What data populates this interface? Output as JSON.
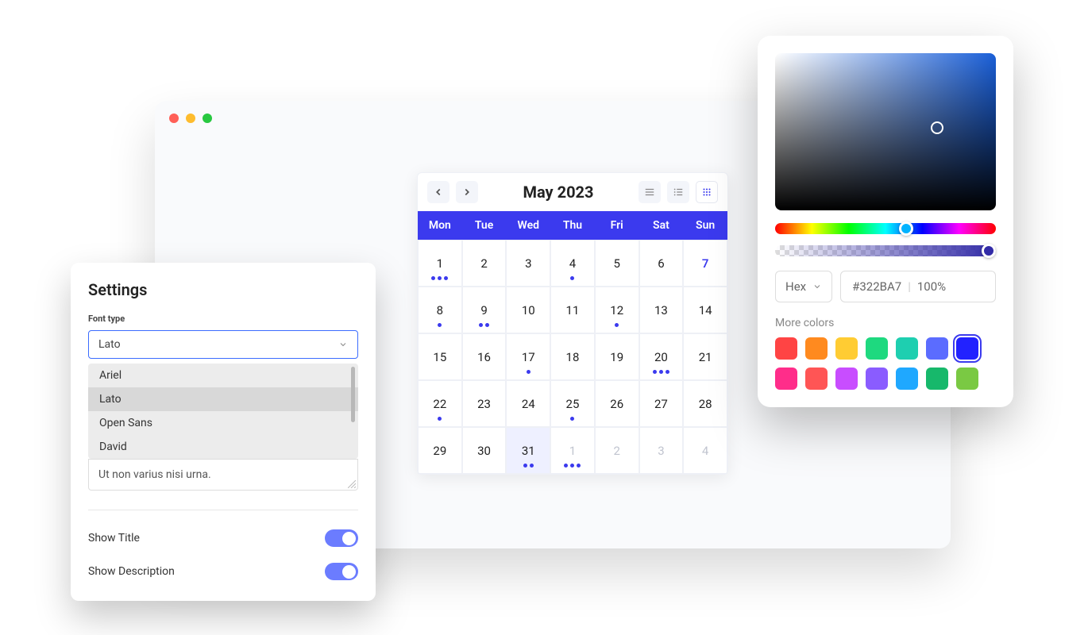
{
  "calendar": {
    "title": "May 2023",
    "days": [
      "Mon",
      "Tue",
      "Wed",
      "Thu",
      "Fri",
      "Sat",
      "Sun"
    ],
    "cells": [
      {
        "n": "1",
        "dots": 3
      },
      {
        "n": "2"
      },
      {
        "n": "3"
      },
      {
        "n": "4",
        "dots": 1
      },
      {
        "n": "5"
      },
      {
        "n": "6"
      },
      {
        "n": "7",
        "highlight": true
      },
      {
        "n": "8",
        "dots": 1
      },
      {
        "n": "9",
        "dots": 2
      },
      {
        "n": "10"
      },
      {
        "n": "11"
      },
      {
        "n": "12",
        "dots": 1
      },
      {
        "n": "13"
      },
      {
        "n": "14"
      },
      {
        "n": "15"
      },
      {
        "n": "16"
      },
      {
        "n": "17",
        "dots": 1
      },
      {
        "n": "18"
      },
      {
        "n": "19"
      },
      {
        "n": "20",
        "dots": 3
      },
      {
        "n": "21"
      },
      {
        "n": "22",
        "dots": 1
      },
      {
        "n": "23"
      },
      {
        "n": "24"
      },
      {
        "n": "25",
        "dots": 1
      },
      {
        "n": "26"
      },
      {
        "n": "27"
      },
      {
        "n": "28"
      },
      {
        "n": "29"
      },
      {
        "n": "30"
      },
      {
        "n": "31",
        "dots": 2,
        "selected": true
      },
      {
        "n": "1",
        "dots": 3,
        "fade": true
      },
      {
        "n": "2",
        "fade": true
      },
      {
        "n": "3",
        "fade": true
      },
      {
        "n": "4",
        "fade": true
      }
    ]
  },
  "settings": {
    "title": "Settings",
    "font_label": "Font type",
    "font_value": "Lato",
    "font_options": [
      "Ariel",
      "Lato",
      "Open Sans",
      "David"
    ],
    "textarea": "Ut non varius nisi urna.",
    "show_title": "Show Title",
    "show_description": "Show Description"
  },
  "picker": {
    "format": "Hex",
    "hex": "#322BA7",
    "opacity": "100%",
    "more_label": "More colors",
    "row1": [
      "#ff4444",
      "#ff8a1f",
      "#ffcc33",
      "#1ed97f",
      "#1ecfb0",
      "#5b6cff",
      "#2222ff"
    ],
    "row2": [
      "#ff2d8a",
      "#ff5555",
      "#c84dff",
      "#8a5cff",
      "#1fa8ff",
      "#17b86b",
      "#7ac943"
    ],
    "active_index": 6
  }
}
